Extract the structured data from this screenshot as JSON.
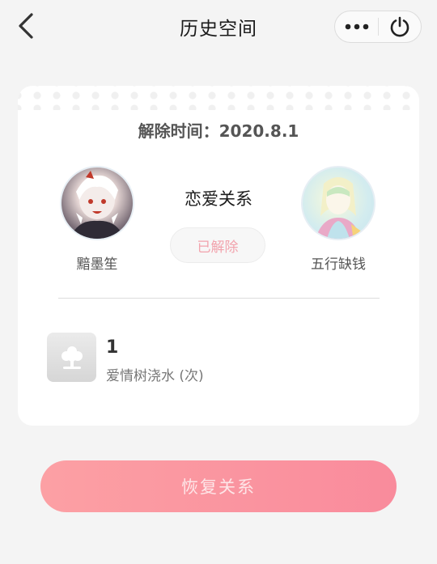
{
  "header": {
    "title": "历史空间",
    "back_icon": "chevron-left-icon",
    "more_icon": "more-dots-icon",
    "power_icon": "power-icon"
  },
  "card": {
    "release_time": "解除时间：2020.8.1",
    "relation_type": "恋爱关系",
    "status": "已解除",
    "left_user": {
      "name": "黯墨笙"
    },
    "right_user": {
      "name": "五行缺钱"
    },
    "stats": [
      {
        "value": "1",
        "label": "爱情树浇水 (次)",
        "icon": "tree-icon"
      }
    ]
  },
  "restore_button": {
    "label": "恢复关系"
  },
  "colors": {
    "background": "#f4f4f4",
    "card": "#ffffff",
    "status_text": "#f2a3ad",
    "button_start": "#fca0a4",
    "button_end": "#f98b9c"
  }
}
